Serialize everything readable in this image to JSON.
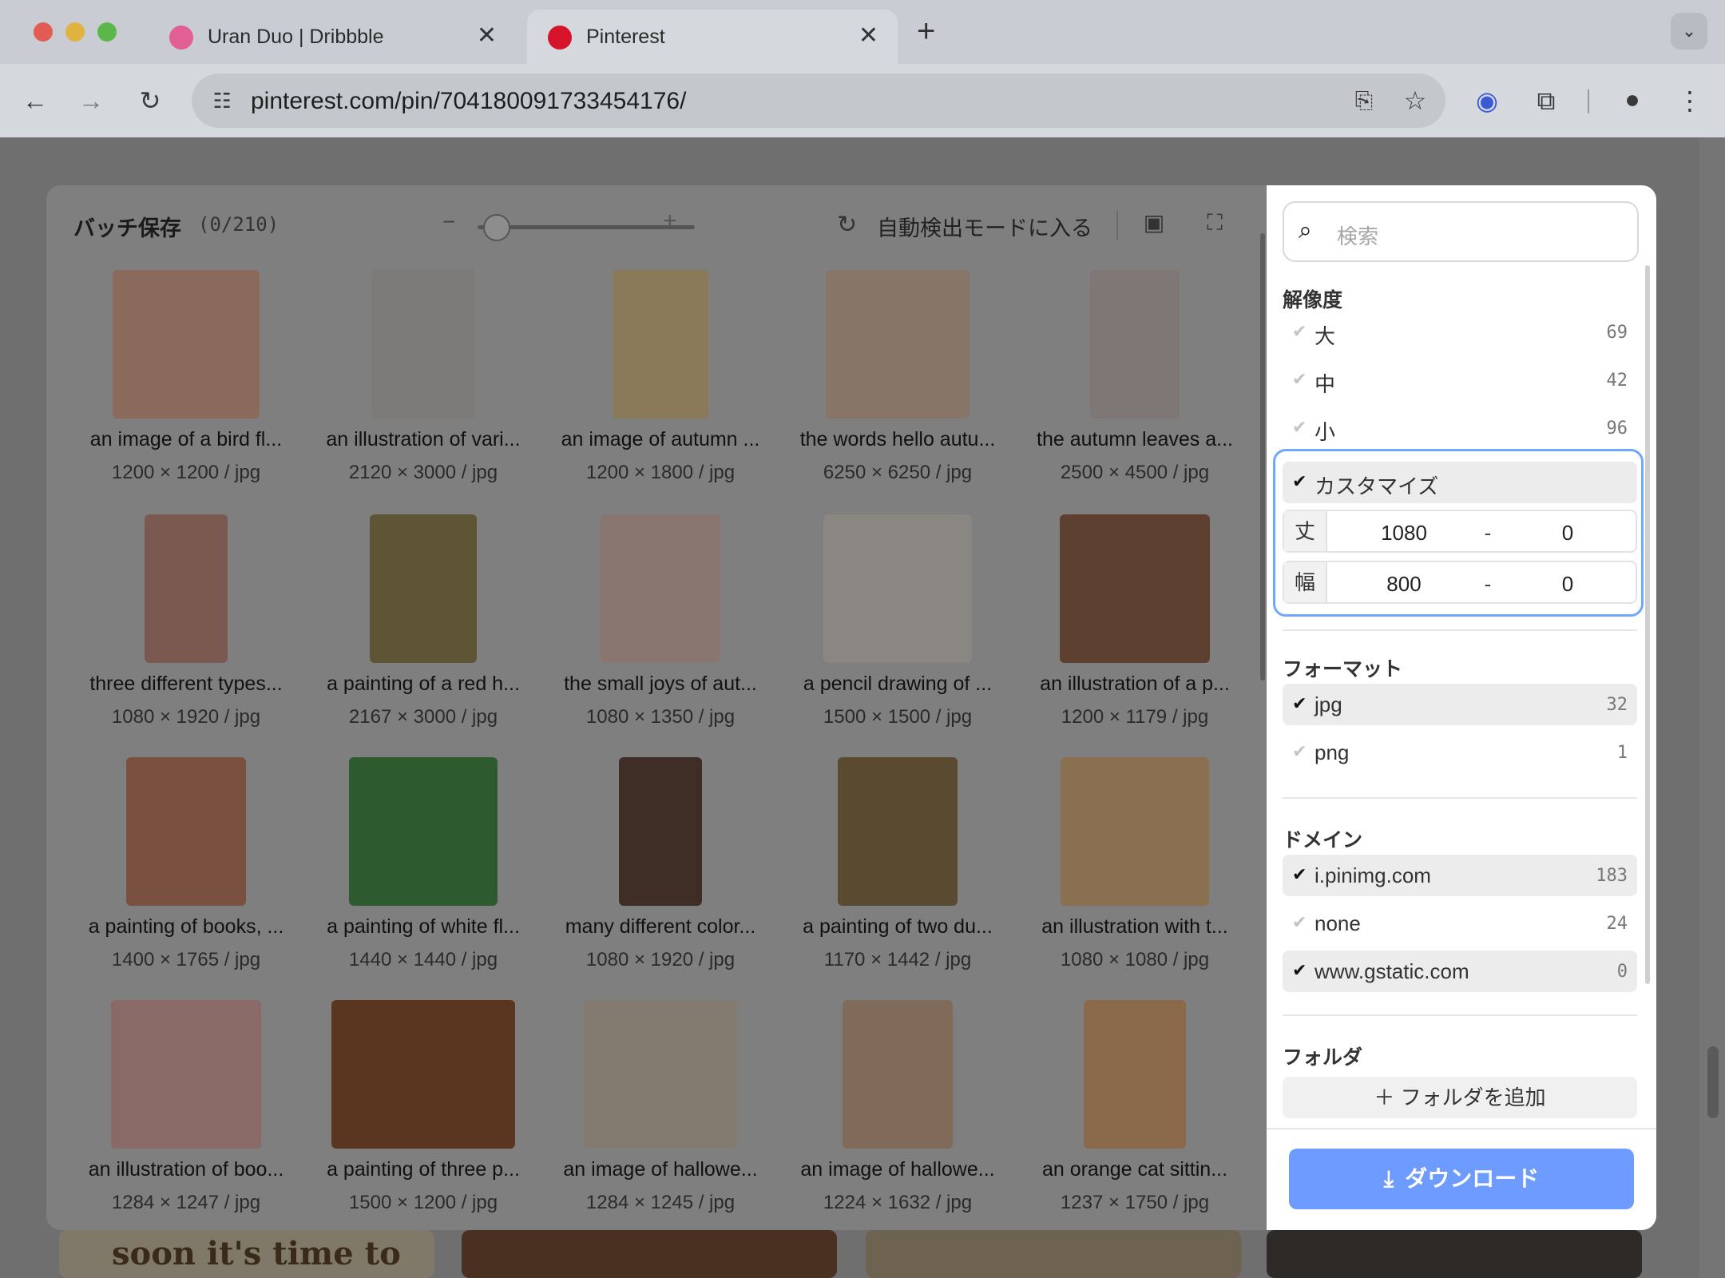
{
  "browser": {
    "tabs": [
      {
        "title": "Uran Duo | Dribbble",
        "favicon": "dribbble-icon",
        "active": false
      },
      {
        "title": "Pinterest",
        "favicon": "pinterest-icon",
        "active": true
      }
    ],
    "close_glyph": "✕",
    "new_tab_glyph": "+",
    "url": "pinterest.com/pin/704180091733454176/"
  },
  "modal": {
    "title": "バッチ保存",
    "count": "(0/210)",
    "slider_value": 0.08,
    "auto_detect_label": "自動検出モードに入る",
    "items": [
      {
        "caption": "an image of a bird fl...",
        "meta": "1200 × 1200 / jpg",
        "color": "#8a6a5a"
      },
      {
        "caption": "an illustration of vari...",
        "meta": "2120 × 3000 / jpg",
        "color": "#7d7b79"
      },
      {
        "caption": "an image of autumn ...",
        "meta": "1200 × 1800 / jpg",
        "color": "#8a7a5a"
      },
      {
        "caption": "the words hello autu...",
        "meta": "6250 × 6250 / jpg",
        "color": "#877567"
      },
      {
        "caption": "the autumn leaves a...",
        "meta": "2500 × 4500 / jpg",
        "color": "#7f7775"
      },
      {
        "caption": "three different types...",
        "meta": "1080 × 1920 / jpg",
        "color": "#7a5a50"
      },
      {
        "caption": "a painting of a red h...",
        "meta": "2167 × 3000 / jpg",
        "color": "#5e5535"
      },
      {
        "caption": "the small joys of aut...",
        "meta": "1080 × 1350 / jpg",
        "color": "#8a7670"
      },
      {
        "caption": "a pencil drawing of ...",
        "meta": "1500 × 1500 / jpg",
        "color": "#8a8682"
      },
      {
        "caption": "an illustration of a p...",
        "meta": "1200 × 1179 / jpg",
        "color": "#5e4030"
      },
      {
        "caption": "a painting of books, ...",
        "meta": "1400 × 1765 / jpg",
        "color": "#7a5040"
      },
      {
        "caption": "a painting of white fl...",
        "meta": "1440 × 1440 / jpg",
        "color": "#2e5a30"
      },
      {
        "caption": "many different color...",
        "meta": "1080 × 1920 / jpg",
        "color": "#3e2e26"
      },
      {
        "caption": "a painting of two du...",
        "meta": "1170 × 1442 / jpg",
        "color": "#5a4a30"
      },
      {
        "caption": "an illustration with t...",
        "meta": "1080 × 1080 / jpg",
        "color": "#8a7050"
      },
      {
        "caption": "an illustration of boo...",
        "meta": "1284 × 1247 / jpg",
        "color": "#8a6a66"
      },
      {
        "caption": "a painting of three p...",
        "meta": "1500 × 1200 / jpg",
        "color": "#5a3520"
      },
      {
        "caption": "an image of hallowe...",
        "meta": "1284 × 1245 / jpg",
        "color": "#837a70"
      },
      {
        "caption": "an image of hallowe...",
        "meta": "1224 × 1632 / jpg",
        "color": "#806a5a"
      },
      {
        "caption": "an orange cat sittin...",
        "meta": "1237 × 1750 / jpg",
        "color": "#8a6a4a"
      }
    ]
  },
  "panel": {
    "search_placeholder": "検索",
    "resolution": {
      "title": "解像度",
      "options": [
        {
          "label": "大",
          "count": "69",
          "selected": false
        },
        {
          "label": "中",
          "count": "42",
          "selected": false
        },
        {
          "label": "小",
          "count": "96",
          "selected": false
        }
      ],
      "custom": {
        "label": "カスタマイズ",
        "selected": true,
        "height": {
          "key": "丈",
          "from": "1080",
          "to": "0"
        },
        "width": {
          "key": "幅",
          "from": "800",
          "to": "0"
        },
        "range_sep": "-"
      }
    },
    "format": {
      "title": "フォーマット",
      "options": [
        {
          "label": "jpg",
          "count": "32",
          "selected": true
        },
        {
          "label": "png",
          "count": "1",
          "selected": false
        }
      ]
    },
    "domain": {
      "title": "ドメイン",
      "options": [
        {
          "label": "i.pinimg.com",
          "count": "183",
          "selected": true
        },
        {
          "label": "none",
          "count": "24",
          "selected": false
        },
        {
          "label": "www.gstatic.com",
          "count": "0",
          "selected": true
        }
      ]
    },
    "folder": {
      "title": "フォルダ",
      "add_label": "＋ フォルダを追加"
    },
    "download_label": "ダウンロード",
    "check_glyph": "✔"
  },
  "background": {
    "visible_text": "soon it's time to"
  },
  "colors": {
    "accent": "#6d9bff",
    "custom_outline": "#6fa8ff",
    "close_red": "#e25c53",
    "minimize_yellow": "#e0b341",
    "zoom_green": "#5bb74a",
    "pinterest_red": "#d6132a",
    "dribbble_pink": "#e25f95"
  }
}
